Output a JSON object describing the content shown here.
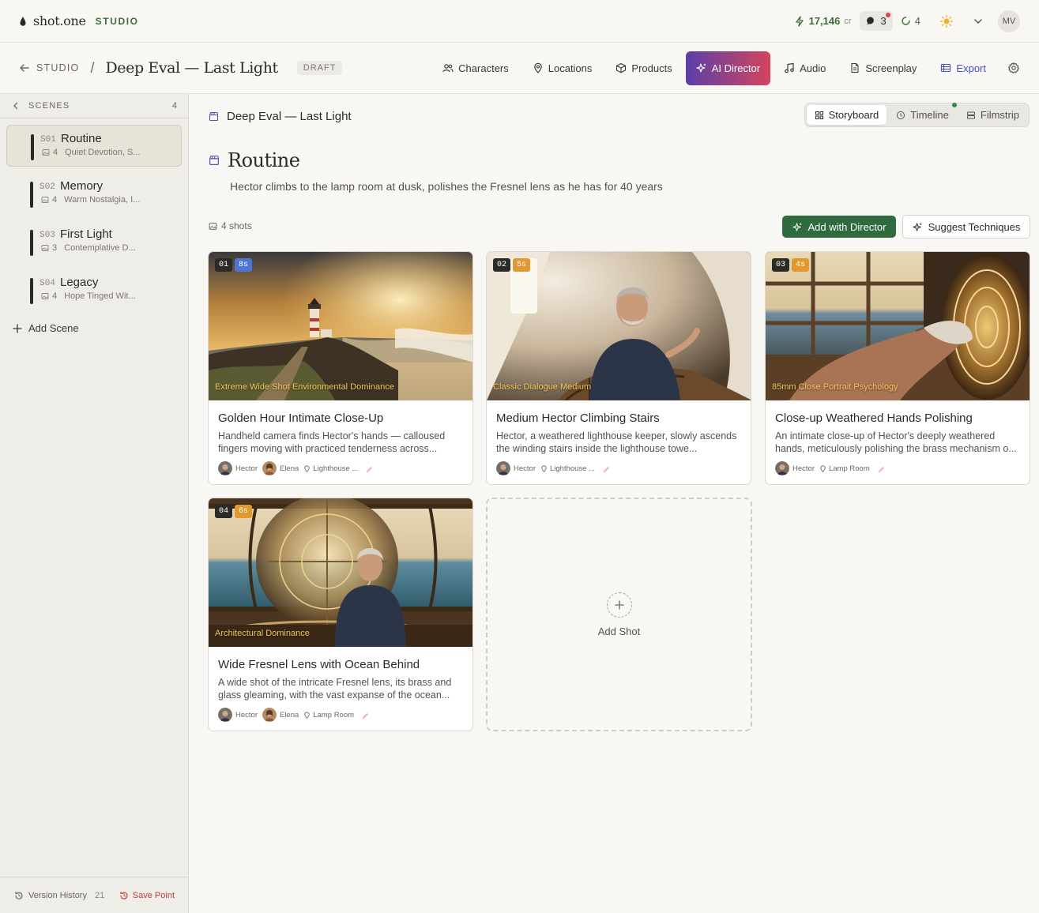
{
  "app": {
    "brand": "shot.one",
    "studio_label": "STUDIO"
  },
  "topbar": {
    "credits": "17,146",
    "credits_unit": "cr",
    "messages": "3",
    "sync_count": "4",
    "user_initials": "MV"
  },
  "nav": {
    "back_label": "STUDIO",
    "separator": "/",
    "project_title": "Deep Eval — Last Light",
    "status": "DRAFT",
    "tabs": [
      {
        "label": "Characters"
      },
      {
        "label": "Locations"
      },
      {
        "label": "Products"
      },
      {
        "label": "AI Director"
      },
      {
        "label": "Audio"
      },
      {
        "label": "Screenplay"
      },
      {
        "label": "Export"
      }
    ]
  },
  "sidebar": {
    "header": "SCENES",
    "count": "4",
    "scenes": [
      {
        "num": "S01",
        "title": "Routine",
        "shots": "4",
        "mood": "Quiet Devotion, S..."
      },
      {
        "num": "S02",
        "title": "Memory",
        "shots": "4",
        "mood": "Warm Nostalgia, I..."
      },
      {
        "num": "S03",
        "title": "First Light",
        "shots": "3",
        "mood": "Contemplative D..."
      },
      {
        "num": "S04",
        "title": "Legacy",
        "shots": "4",
        "mood": "Hope Tinged Wit..."
      }
    ],
    "add_scene": "Add Scene",
    "version_history": "Version History",
    "version_count": "21",
    "save_point": "Save Point"
  },
  "main": {
    "breadcrumb": "Deep Eval — Last Light",
    "view_tabs": [
      {
        "label": "Storyboard"
      },
      {
        "label": "Timeline"
      },
      {
        "label": "Filmstrip"
      }
    ],
    "scene_title": "Routine",
    "scene_description": "Hector climbs to the lamp room at dusk, polishes the Fresnel lens as he has for 40 years",
    "shots_count": "4 shots",
    "add_with_director": "Add with Director",
    "suggest_techniques": "Suggest Techniques",
    "add_shot": "Add Shot",
    "shots": [
      {
        "num": "01",
        "duration": "8s",
        "duration_color": "#4f74d6",
        "technique": "Extreme Wide Shot Environmental Dominance",
        "title": "Golden Hour Intimate Close-Up",
        "description": "Handheld camera finds Hector's hands — calloused fingers moving with practiced tenderness across...",
        "characters": [
          "Hector",
          "Elena"
        ],
        "location": "Lighthouse ..."
      },
      {
        "num": "02",
        "duration": "5s",
        "duration_color": "#e0982f",
        "technique": "Classic Dialogue Medium",
        "title": "Medium Hector Climbing Stairs",
        "description": "Hector, a weathered lighthouse keeper, slowly ascends the winding stairs inside the lighthouse towe...",
        "characters": [
          "Hector"
        ],
        "location": "Lighthouse ..."
      },
      {
        "num": "03",
        "duration": "4s",
        "duration_color": "#e0982f",
        "technique": "85mm Close Portrait Psychology",
        "title": "Close-up Weathered Hands Polishing",
        "description": "An intimate close-up of Hector's deeply weathered hands, meticulously polishing the brass mechanism o...",
        "characters": [
          "Hector"
        ],
        "location": "Lamp Room"
      },
      {
        "num": "04",
        "duration": "6s",
        "duration_color": "#e0982f",
        "technique": "Architectural Dominance",
        "title": "Wide Fresnel Lens with Ocean Behind",
        "description": "A wide shot of the intricate Fresnel lens, its brass and glass gleaming, with the vast expanse of the ocean...",
        "characters": [
          "Hector",
          "Elena"
        ],
        "location": "Lamp Room"
      }
    ]
  }
}
